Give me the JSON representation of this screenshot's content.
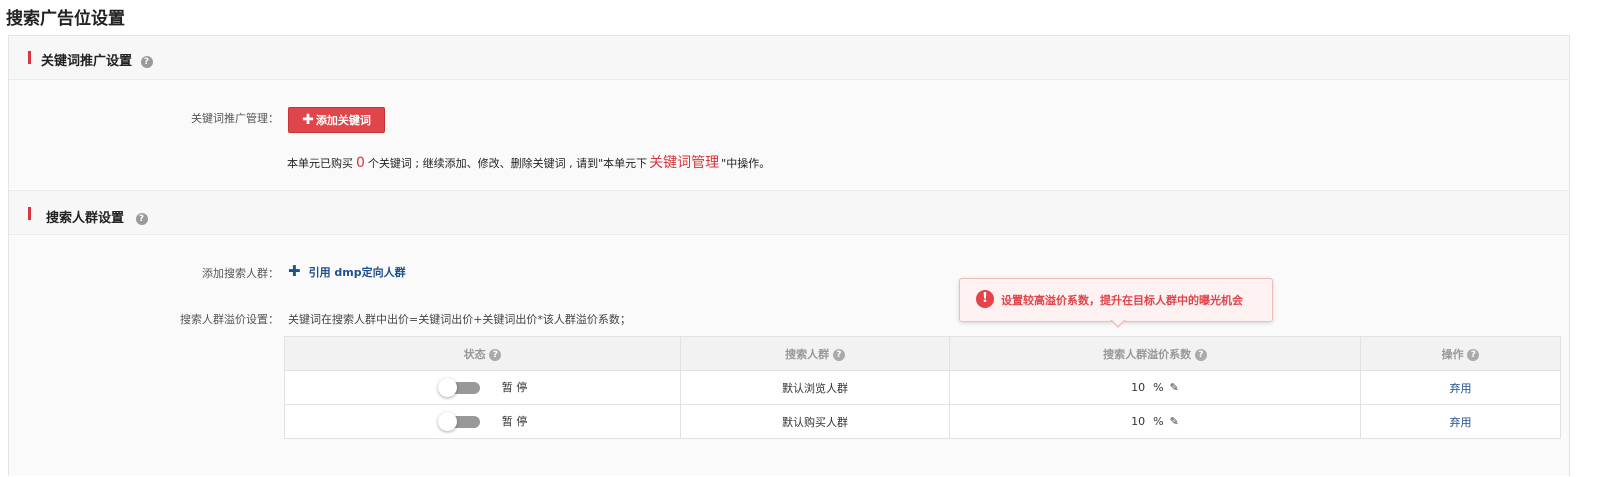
{
  "page_title": "搜索广告位设置",
  "keyword_section": {
    "title": "关键词推广设置",
    "manage_label": "关键词推广管理：",
    "add_button": "添加关键词",
    "info_prefix": "本单元已购买",
    "info_count": "0",
    "info_middle": "个关键词 ; 继续添加、修改、删除关键词 , 请到\"本单元下",
    "info_link": "关键词管理",
    "info_suffix": "\"中操作。"
  },
  "crowd_section": {
    "title": "搜索人群设置",
    "add_label": "添加搜索人群：",
    "add_link": "引用 dmp定向人群",
    "premium_label": "搜索人群溢价设置：",
    "formula": "关键词在搜索人群中出价=关键词出价+关键词出价*该人群溢价系数；",
    "tooltip": "设置较高溢价系数，提升在目标人群中的曝光机会",
    "columns": [
      "状态",
      "搜索人群",
      "搜索人群溢价系数",
      "操作"
    ],
    "rows": [
      {
        "status": "暂 停",
        "crowd": "默认浏览人群",
        "premium": "10",
        "unit": "%",
        "action": "弃用"
      },
      {
        "status": "暂 停",
        "crowd": "默认购买人群",
        "premium": "10",
        "unit": "%",
        "action": "弃用"
      }
    ]
  },
  "colors": {
    "accent_red": "#d4373d",
    "link_blue": "#1f4f8f"
  }
}
